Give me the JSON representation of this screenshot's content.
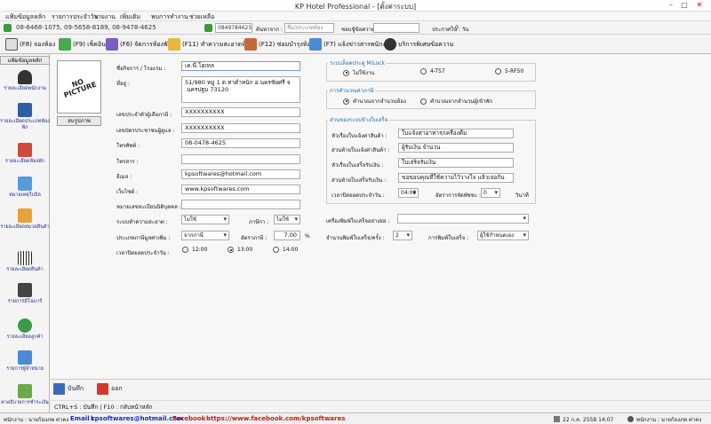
{
  "window": {
    "title": "KP Hotel Professional - [ตั้งค่าระบบ]",
    "minimize": "–",
    "maximize": "□",
    "close": "✕"
  },
  "menu": [
    "แฟ้มข้อมูลหลัก",
    "รายการประจำวัน",
    "รายงาน",
    "เพิ่มเติม",
    "พบการทำงาน",
    "ช่วยเหลือ"
  ],
  "info": {
    "phones": "08-6468-1075, 09-5658-8189, 08-9478-4625",
    "phone_field": "0849784625",
    "search_label": "ค้นหาจาก :",
    "search_select": "ชื่อ/ประเภทห้อง",
    "free_label": "ชอบชู้ข้อความ :",
    "page_label": "ประกาศใน :",
    "page_value": "0",
    "page_unit": "วัน"
  },
  "toolbar": [
    {
      "label": "(F8) จองห้อง",
      "icon": "calendar-icon"
    },
    {
      "label": "(F9) เช็คอิน",
      "icon": "checkin-icon"
    },
    {
      "label": "(F6) จัดการห้องพัก",
      "icon": "room-manage-icon"
    },
    {
      "label": "(F11) ทำความสะอาดห้อง",
      "icon": "broom-icon"
    },
    {
      "label": "(F12) ซ่อมบำรุงห้อง",
      "icon": "repair-icon"
    },
    {
      "label": "(F7) แจ้งข่าวสารพนักงาน",
      "icon": "news-icon"
    },
    {
      "label": "บริการพิเศษข้อความ",
      "icon": "phone-service-icon"
    }
  ],
  "sidebar": {
    "tab": "แฟ้มข้อมูลหลัก",
    "items": [
      {
        "label": "รายละเอียดพนักงาน",
        "icon": "employee-icon"
      },
      {
        "label": "รายละเอียดประเภทห้องพัก",
        "icon": "room-type-icon"
      },
      {
        "label": "รายละเอียดห้องพัก",
        "icon": "room-icon"
      },
      {
        "label": "หมายเหตุใบบิล",
        "icon": "note-icon"
      },
      {
        "label": "รายละเอียดหมวดสินค้า",
        "icon": "category-icon"
      },
      {
        "label": "รายละเอียดสินค้า",
        "icon": "barcode-icon"
      },
      {
        "label": "รายการมีโนบาร์",
        "icon": "minibar-icon"
      },
      {
        "label": "รายละเอียดลูกค้า",
        "icon": "customer-icon"
      },
      {
        "label": "รายการผู้จำหน่าย",
        "icon": "supplier-icon"
      },
      {
        "label": "ค่าอธิบายการชำระเงิน",
        "icon": "payment-icon"
      }
    ]
  },
  "photo": {
    "text": "NO PICTURE",
    "button": "ลบรูปภาพ"
  },
  "form": {
    "name_label": "ชื่อกิจการ / โรงแรม :",
    "name_value": "เค.พี.โฮเทล",
    "address_label": "ที่อยู่ :",
    "address_line1": "51/980 หมู่ 1 ต.ท่าตำหนัก อ.นครชัยศรี จ",
    "address_line2": ".นครปฐม 73120",
    "taxid_label": "เลขประจำตัวผู้เสียภาษี :",
    "taxid_value": "XXXXXXXXXX",
    "idcard_label": "เลขบัตรประชาชนผู้ดูแล :",
    "idcard_value": "XXXXXXXXXX",
    "phone_label": "โทรศัพท์ :",
    "phone_value": "08-0478-4625",
    "fax_label": "โทรสาร :",
    "fax_value": "",
    "email_label": "อีเมล :",
    "email_value": "kpsoftwares@hotmail.com",
    "website_label": "เว็บไซต์ :",
    "website_value": "www.kpsoftwares.com",
    "reg_label": "หมายเลขทะเบียนนิติบุคคล :",
    "reg_value": "",
    "clean_label": "ระบบทำความสะอาด :",
    "clean_value": "ไม่ใช้",
    "tax_label": "ภาษีกา :",
    "tax_value": "ไม่ใช้",
    "vat_type_label": "ประเภทภาษีมูลค่าเพิ่ม :",
    "vat_type_value": "จากภาษี",
    "vat_rate_label": "อัตราภาษี :",
    "vat_rate_value": "7.00",
    "vat_unit": "%",
    "checkout_label": "เวลาปิดยอดประจำวัน :",
    "checkout_options": [
      "12:00",
      "13:00",
      "14:00"
    ]
  },
  "milock": {
    "title": "ระบบล็อคประตู MiLock",
    "options": [
      "ไม่ใช้งาน",
      "4-T57",
      "5-RF50"
    ]
  },
  "calc": {
    "title": "การคำนวณค่าภาษี",
    "options": [
      "คำนวณจากจำนวนห้อง",
      "คำนวณจากจำนวนผู้เข้าพัก"
    ]
  },
  "receipt": {
    "title": "ส่วนของระบบข้างใบเสร็จ",
    "head_label": "หัวเรื่องใบแจ้งค่าสินค้า :",
    "head_value": "ใบแจ้งค่าอาหาร/เครื่องดื่ม",
    "bottom_label": "ส่วนท้ายใบแจ้งค่าสินค้า :",
    "bottom_value": "ผู้รับเงิน               จำนวน",
    "rec_head_label": "หัวเรื่องใบเสร็จรับเงิน :",
    "rec_head_value": "ใบเสร็จรับเงิน",
    "rec_bottom_label": "ส่วนท้ายใบเสร็จรับเงิน :",
    "rec_bottom_value": "ขอขอบคุณที่ใช้ความไว้วางใจ แล้วเจอกัน",
    "close_label": "เวลาปิดยอดประจำวัน :",
    "close_value": "04:00",
    "day_label": "อัตราการจัดพัชชะ :",
    "day_value": "0",
    "day_unit": "วินาที"
  },
  "printer": {
    "printer_label": "เครื่องพิมพ์ใบเสร็จอย่างย่อ :",
    "printer_value": "",
    "copies_label": "จำนวนพิมพ์ใบเสร็จ/ครั้ง :",
    "copies_value": "2",
    "print_type_label": "การพิมพ์ใบเสร็จ :",
    "print_type_value": "ผู้ใช้กำหนดเอง"
  },
  "actions": {
    "save": "บันทึก",
    "exit": "ออก"
  },
  "hint": "CTRL+S : บันทึก  |  F10 : กลับหน้าหลัก",
  "status": {
    "employee": "พนักงาน : นายก้องภพ ค่าคง",
    "email_label": "Email :",
    "email": "kpsoftwares@hotmail.com",
    "fb_label": "Facebook :",
    "fb": "https://www.facebook.com/kpsoftwares",
    "datetime": "22 ก.ค. 2558 14:07",
    "user": "พนักงาน : นายก้องภพ ค่าคง"
  }
}
